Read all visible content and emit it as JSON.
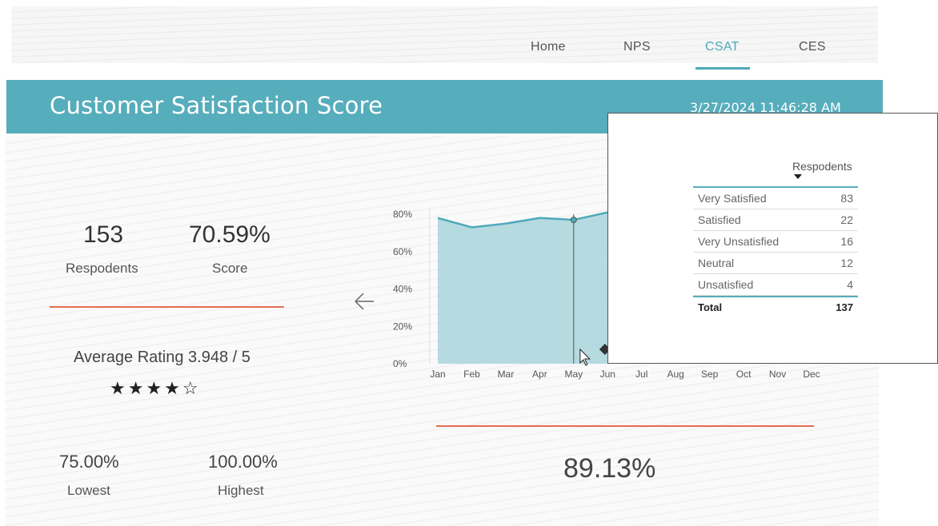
{
  "nav": {
    "items": [
      {
        "label": "Home"
      },
      {
        "label": "NPS"
      },
      {
        "label": "CSAT"
      },
      {
        "label": "CES"
      }
    ],
    "active": "CSAT"
  },
  "banner": {
    "title": "Customer Satisfaction Score",
    "datetime": "3/27/2024 11:46:28 AM"
  },
  "kpis": {
    "respondents_value": "153",
    "respondents_label": "Respodents",
    "score_value": "70.59%",
    "score_label": "Score",
    "average_rating": "Average Rating 3.948 / 5",
    "stars": "★★★★☆",
    "rating_value": 3.948,
    "rating_max": 5,
    "lowest_value": "75.00%",
    "lowest_label": "Lowest",
    "highest_value": "100.00%",
    "highest_label": "Highest",
    "overall_value": "89.13%"
  },
  "colors": {
    "accent": "#56adbb",
    "line": "#4ea9b8",
    "area": "#a8d3db",
    "divider": "#e46d4f"
  },
  "chart_data": {
    "type": "area",
    "categories": [
      "Jan",
      "Feb",
      "Mar",
      "Apr",
      "May",
      "Jun",
      "Jul",
      "Aug",
      "Sep",
      "Oct",
      "Nov",
      "Dec"
    ],
    "values": [
      78,
      73,
      75,
      78,
      77,
      81,
      null,
      null,
      null,
      null,
      null,
      null
    ],
    "y_ticks": [
      "0%",
      "20%",
      "40%",
      "60%",
      "80%"
    ],
    "ylim": [
      0,
      80
    ],
    "grid": false,
    "highlight_category": "May"
  },
  "tooltip": {
    "column_header": "Respodents",
    "rows": [
      {
        "label": "Very Satisfied",
        "value": "83"
      },
      {
        "label": "Satisfied",
        "value": "22"
      },
      {
        "label": "Very Unsatisfied",
        "value": "16"
      },
      {
        "label": "Neutral",
        "value": "12"
      },
      {
        "label": "Unsatisfied",
        "value": "4"
      }
    ],
    "total_label": "Total",
    "total_value": "137"
  }
}
